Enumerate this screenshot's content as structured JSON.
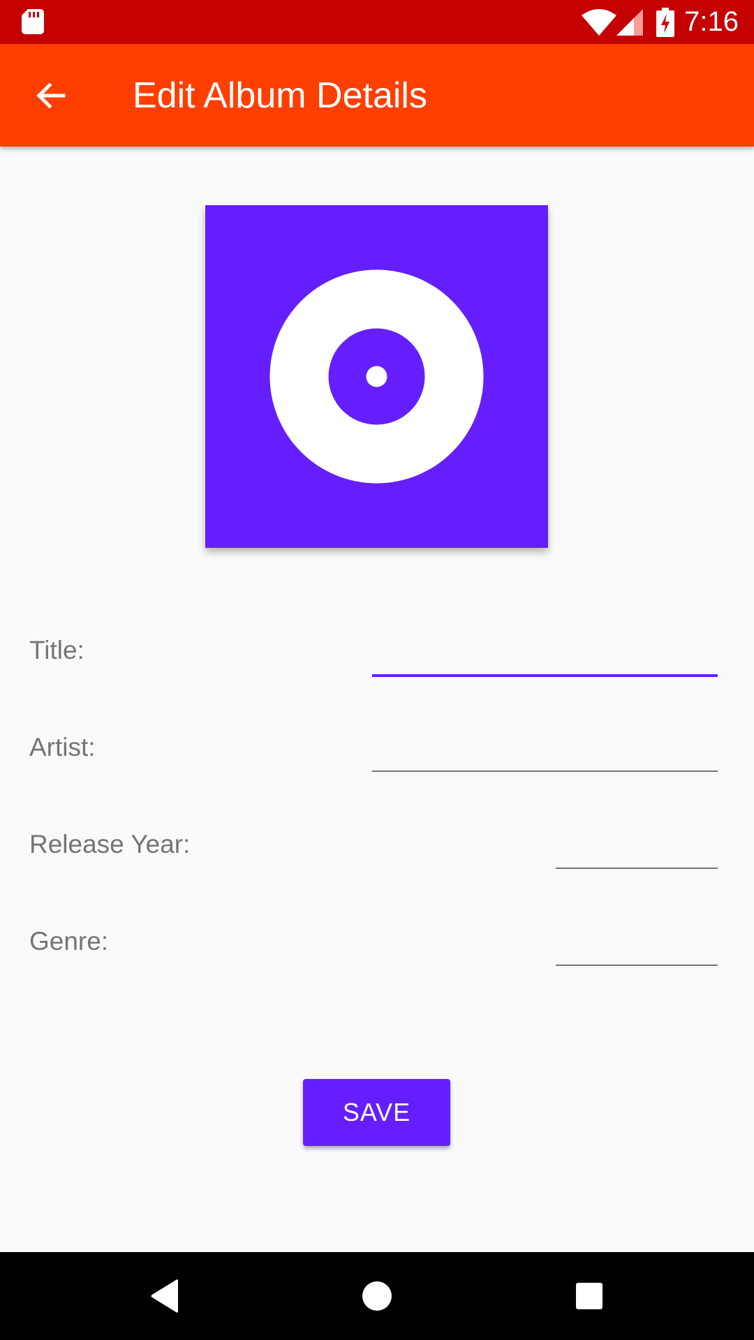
{
  "status_bar": {
    "time": "7:16",
    "icons": [
      "sd-card-icon",
      "wifi-icon",
      "signal-icon",
      "battery-charging-icon"
    ],
    "background": "#c40000"
  },
  "app_bar": {
    "title": "Edit Album Details",
    "back_icon": "arrow-back-icon",
    "background": "#ff3f00"
  },
  "album_art": {
    "icon": "album-disc-icon",
    "background": "#651fff"
  },
  "form": {
    "fields": [
      {
        "label": "Title:",
        "value": "",
        "focused": true
      },
      {
        "label": "Artist:",
        "value": "",
        "focused": false
      },
      {
        "label": "Release Year:",
        "value": "",
        "focused": false
      },
      {
        "label": "Genre:",
        "value": "",
        "focused": false
      }
    ],
    "accent": "#651fff"
  },
  "save_button": {
    "label": "SAVE"
  },
  "nav_bar": {
    "icons": [
      "back-triangle-icon",
      "home-circle-icon",
      "recents-square-icon"
    ]
  }
}
